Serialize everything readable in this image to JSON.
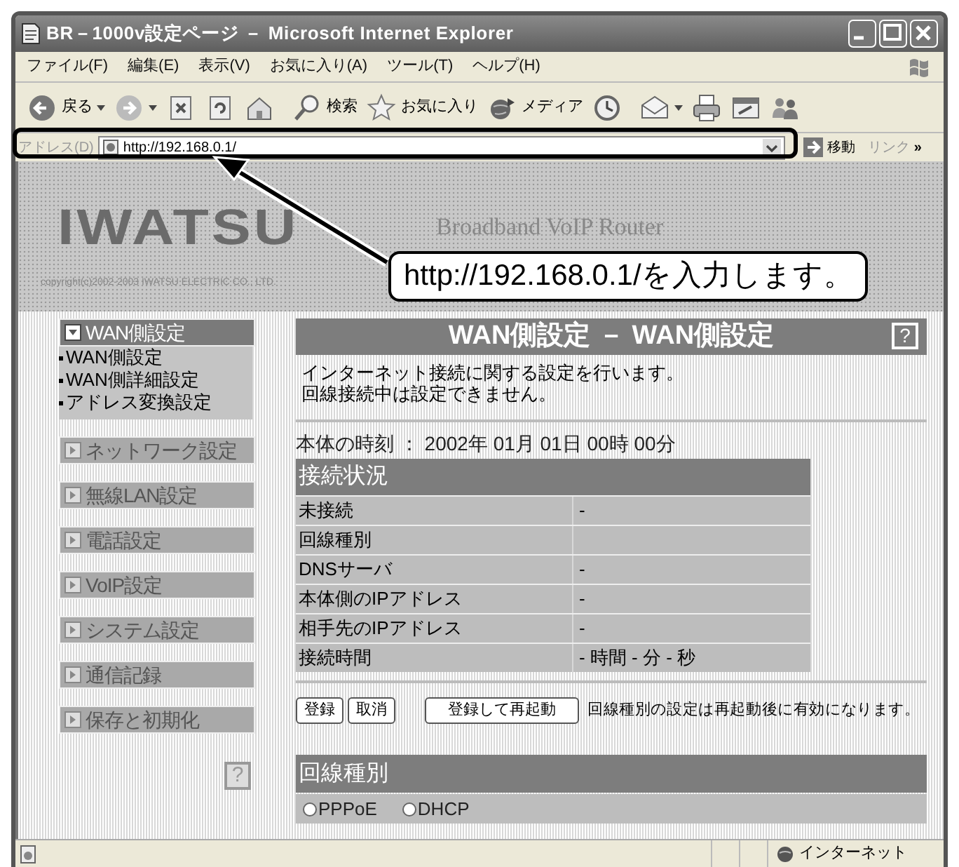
{
  "window": {
    "title": "BR－1000v設定ページ － Microsoft Internet Explorer"
  },
  "menu_bar": [
    "ファイル(F)",
    "編集(E)",
    "表示(V)",
    "お気に入り(A)",
    "ツール(T)",
    "ヘルプ(H)"
  ],
  "toolbar": [
    {
      "kind": "back",
      "label": "戻る"
    },
    {
      "kind": "forward"
    },
    {
      "kind": "stop"
    },
    {
      "kind": "refresh"
    },
    {
      "kind": "home"
    },
    {
      "kind": "search",
      "label": "検索"
    },
    {
      "kind": "favorites",
      "label": "お気に入り"
    },
    {
      "kind": "media",
      "label": "メディア"
    },
    {
      "kind": "history"
    },
    {
      "kind": "mail"
    },
    {
      "kind": "print"
    },
    {
      "kind": "edit"
    },
    {
      "kind": "messenger"
    }
  ],
  "address_bar": {
    "label": "アドレス(D)",
    "value": "http://192.168.0.1/",
    "go": "移動",
    "links": "リンク",
    "more": "»"
  },
  "header": {
    "logo": "IWATSU",
    "tagline": "Broadband VoIP Router",
    "copyright": "copyright(c)2002-2003 IWATSU ELECTRIC CO., LTD."
  },
  "callout": {
    "text": "http://192.168.0.1/を入力します。"
  },
  "sidebar": {
    "groups": [
      {
        "label": "WAN側設定",
        "expanded": true,
        "children": [
          "WAN側設定",
          "WAN側詳細設定",
          "アドレス変換設定"
        ]
      },
      {
        "label": "ネットワーク設定",
        "expanded": false
      },
      {
        "label": "無線LAN設定",
        "expanded": false
      },
      {
        "label": "電話設定",
        "expanded": false
      },
      {
        "label": "VoIP設定",
        "expanded": false
      },
      {
        "label": "システム設定",
        "expanded": false
      },
      {
        "label": "通信記録",
        "expanded": false
      },
      {
        "label": "保存と初期化",
        "expanded": false
      }
    ],
    "help": "?"
  },
  "main": {
    "title": "WAN側設定 － WAN側設定",
    "help": "?",
    "description": [
      "インターネット接続に関する設定を行います。",
      "回線接続中は設定できません。"
    ],
    "clock": "本体の時刻 ： 2002年 01月 01日 00時 00分",
    "status_table": {
      "title": "接続状況",
      "rows": [
        {
          "label": "未接続",
          "value": "-"
        },
        {
          "label": "回線種別"
        },
        {
          "label": "DNSサーバ",
          "value": "-"
        },
        {
          "label": "本体側のIPアドレス",
          "value": "-"
        },
        {
          "label": "相手先のIPアドレス",
          "value": "-"
        },
        {
          "label": "接続時間",
          "value": "- 時間 - 分 - 秒"
        }
      ]
    },
    "buttons": [
      "登録",
      "取消",
      "登録して再起動"
    ],
    "note": "回線種別の設定は再起動後に有効になります。",
    "line_type": {
      "title": "回線種別",
      "options": [
        {
          "label": "PPPoE",
          "selected": false
        },
        {
          "label": "DHCP",
          "selected": false
        }
      ]
    }
  },
  "status_bar": {
    "zone": "インターネット"
  }
}
